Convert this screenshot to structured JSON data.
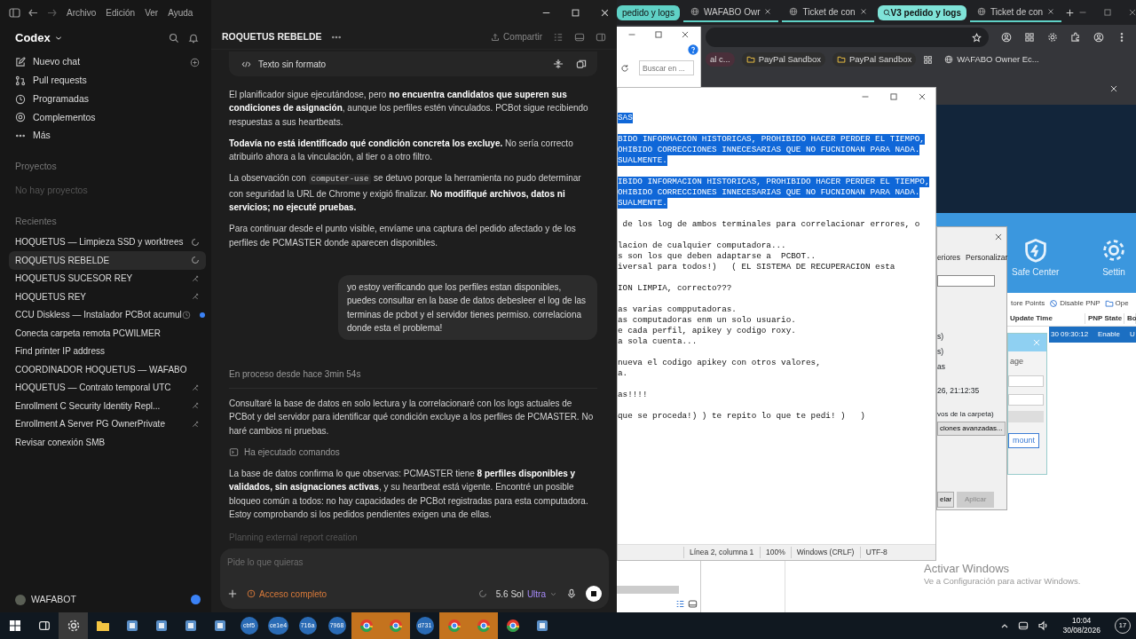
{
  "codex": {
    "menu": [
      "Archivo",
      "Edición",
      "Ver",
      "Ayuda"
    ],
    "app_name": "Codex",
    "nav": [
      {
        "kind": "new",
        "label": "Nuevo chat"
      },
      {
        "kind": "pr",
        "label": "Pull requests"
      },
      {
        "kind": "clock",
        "label": "Programadas"
      },
      {
        "kind": "plugin",
        "label": "Complementos"
      },
      {
        "kind": "more",
        "label": "Más"
      }
    ],
    "projects": {
      "heading": "Proyectos",
      "empty": "No hay proyectos"
    },
    "recents": {
      "heading": "Recientes",
      "items": [
        {
          "label": "HOQUETUS — Limpieza SSD y worktrees",
          "selected": false,
          "kind": "spinner"
        },
        {
          "label": "ROQUETUS REBELDE",
          "selected": true,
          "kind": "spinner"
        },
        {
          "label": "HOQUETUS SUCESOR REY",
          "selected": false,
          "kind": "branch"
        },
        {
          "label": "HOQUETUS REY",
          "selected": false,
          "kind": "branch"
        },
        {
          "label": "CCU Diskless — Instalador PCBot acumul",
          "selected": false,
          "kind": "unread"
        },
        {
          "label": "Conecta carpeta remota PCWILMER",
          "selected": false,
          "kind": "plain"
        },
        {
          "label": "Find printer IP address",
          "selected": false,
          "kind": "plain"
        },
        {
          "label": "COORDINADOR HOQUETUS — WAFABO",
          "selected": false,
          "kind": "plain"
        },
        {
          "label": "HOQUETUS — Contrato temporal UTC",
          "selected": false,
          "kind": "branch"
        },
        {
          "label": "Enrollment C Security Identity Repl...",
          "selected": false,
          "kind": "branch"
        },
        {
          "label": "Enrollment A Server PG OwnerPrivate",
          "selected": false,
          "kind": "branch"
        },
        {
          "label": "Revisar conexión SMB",
          "selected": false,
          "kind": "plain"
        }
      ]
    },
    "user": {
      "name": "WAFABOT"
    },
    "chat": {
      "title": "ROQUETUS REBELDE",
      "share": "Compartir",
      "code_block": "Texto sin formato",
      "messages": [
        {
          "kind": "assistant",
          "segments": [
            {
              "kind": "text",
              "text": "El planificador sigue ejecutándose, pero **no encuentra candidatos que superen sus condiciones de asignación**, aunque los perfiles estén vinculados. PCBot sigue recibiendo respuestas a sus heartbeats."
            }
          ]
        },
        {
          "kind": "assistant",
          "segments": [
            {
              "kind": "text",
              "text": "**Todavía no está identificado qué condición concreta los excluye.** No sería correcto atribuirlo ahora a la vinculación, al tier o a otro filtro."
            }
          ]
        },
        {
          "kind": "assistant",
          "segments": [
            {
              "kind": "text",
              "text": "La observación con "
            },
            {
              "kind": "code",
              "text": "computer-use"
            },
            {
              "kind": "text",
              "text": " se detuvo porque la herramienta no pudo determinar con seguridad la URL de Chrome y exigió finalizar. **No modifiqué archivos, datos ni servicios; no ejecuté pruebas.**"
            }
          ]
        },
        {
          "kind": "assistant",
          "segments": [
            {
              "kind": "text",
              "text": "Para continuar desde el punto visible, envíame una captura del pedido afectado y de los perfiles de PCMASTER donde aparecen disponibles."
            }
          ]
        },
        {
          "kind": "user",
          "segments": [
            {
              "kind": "text",
              "text": "yo estoy verificando que los perfiles estan disponibles, puedes consultar en la base de datos debesleer el log de las terminas de pcbot y el servidor tienes permiso. correlaciona donde esta el problema!"
            }
          ]
        },
        {
          "kind": "status",
          "segments": [
            {
              "kind": "text",
              "text": "En proceso desde hace 3min 54s"
            }
          ]
        },
        {
          "kind": "assistant",
          "segments": [
            {
              "kind": "text",
              "text": "Consultaré la base de datos en solo lectura y la correlacionaré con los logs actuales de PCBot y del servidor para identificar qué condición excluye a los perfiles de PCMASTER. No haré cambios ni pruebas."
            }
          ]
        },
        {
          "kind": "tool",
          "segments": [
            {
              "kind": "text",
              "text": "Ha ejecutado comandos"
            }
          ]
        },
        {
          "kind": "assistant",
          "segments": [
            {
              "kind": "text",
              "text": "La base de datos confirma lo que observas: PCMASTER tiene **8 perfiles disponibles y validados, sin asignaciones activas**, y su heartbeat está vigente. Encontré un posible bloqueo común a todos: no hay capacidades de PCBot registradas para esta computadora. Estoy comprobando si los pedidos pendientes exigen una de ellas."
            }
          ]
        },
        {
          "kind": "thinking",
          "segments": [
            {
              "kind": "text",
              "text": "Planning external report creation"
            }
          ]
        }
      ],
      "composer": {
        "placeholder": "Pide lo que quieras",
        "access": "Acceso completo",
        "model": "5.6 Sol",
        "effort": "Ultra"
      }
    }
  },
  "browser": {
    "tabs": [
      {
        "kind": "group",
        "label": "pedido y logs",
        "selected": false
      },
      {
        "kind": "tab",
        "label": "WAFABO Owr",
        "selected": false
      },
      {
        "kind": "tab",
        "label": "Ticket de con",
        "selected": false
      },
      {
        "kind": "group",
        "label": "V3 pedido y logs",
        "selected": true
      },
      {
        "kind": "tab",
        "label": "Ticket de con",
        "selected": false
      }
    ],
    "bookmarks": [
      {
        "kind": "partial",
        "label": "al c..."
      },
      {
        "kind": "folder",
        "label": "PayPal Sandbox"
      },
      {
        "kind": "folder",
        "label": "PayPal Sandbox"
      },
      {
        "kind": "apps"
      },
      {
        "kind": "site",
        "label": "WAFABO Owner Ec..."
      }
    ]
  },
  "explorer": {
    "search_placeholder": "Buscar en ..."
  },
  "notepad": {
    "paragraphs": [
      {
        "selected": true,
        "lines": [
          "SAS"
        ]
      },
      {
        "selected": true,
        "lines": [
          "BIDO INFORMACION HISTORICAS, PROHIBIDO HACER PERDER EL TIEMPO,",
          "OHIBIDO CORRECCIONES INNECESARIAS QUE NO FUCNIONAN PARA NADA.",
          "SUALMENTE."
        ]
      },
      {
        "selected": true,
        "lines": [
          "IBIDO INFORMACION HISTORICAS, PROHIBIDO HACER PERDER EL TIEMPO,",
          "OHIBIDO CORRECCIONES INNECESARIAS QUE NO FUCNIONAN PARA NADA.",
          "SUALMENTE."
        ]
      },
      {
        "selected": false,
        "lines": [
          " de los log de ambos terminales para correlacionar errores, o"
        ]
      },
      {
        "selected": false,
        "lines": [
          "lacion de cualquier computadora...",
          "s son los que deben adaptarse a  PCBOT..",
          "iversal para todos!)   ( EL SISTEMA DE RECUPERACION esta"
        ]
      },
      {
        "selected": false,
        "lines": [
          "ION LIMPIA, correcto???"
        ]
      },
      {
        "selected": false,
        "lines": [
          "as varias compputadoras.",
          "as computadoras enm un solo usuario.",
          "e cada perfil, apikey y codigo roxy.",
          "a sola cuenta..."
        ]
      },
      {
        "selected": false,
        "lines": [
          "nueva el codigo apikey con otros valores,",
          "a."
        ]
      },
      {
        "selected": false,
        "lines": [
          "as!!!!"
        ]
      },
      {
        "selected": false,
        "lines": [
          "que se proceda!) ) te repito lo que te pedi! )   )"
        ]
      }
    ],
    "status": [
      "Línea 2, columna 1",
      "100%",
      "Windows (CRLF)",
      "UTF-8"
    ]
  },
  "security_app": {
    "tiles": [
      {
        "kind": "shield",
        "label": "Safe Center"
      },
      {
        "kind": "gear",
        "label": "Settin"
      }
    ],
    "toolbar": [
      {
        "kind": "restore",
        "label": "tore Points"
      },
      {
        "kind": "disable",
        "label": "Disable PNP"
      },
      {
        "kind": "open",
        "label": "Ope"
      }
    ],
    "columns": [
      "Update Time",
      "PNP State",
      "Bo"
    ],
    "row": {
      "cells": [
        "30 09:30:12",
        "Enable",
        "U"
      ],
      "selected": true
    },
    "dialog": {
      "label": "age",
      "button": "mount"
    }
  },
  "properties": {
    "tabs": [
      "eriores",
      "Personalizar"
    ],
    "items": [
      "s)",
      "s)",
      "as"
    ],
    "date": "26, 21:12:35",
    "note": "vos de la carpeta)",
    "advanced": "ciones avanzadas...",
    "cancel": "elar",
    "apply": "Aplicar"
  },
  "activation": {
    "title": "Activar Windows",
    "subtitle": "Ve a Configuración para activar Windows."
  },
  "taskbar": {
    "apps": [
      {
        "kind": "start",
        "highlighted": false
      },
      {
        "kind": "taskview",
        "highlighted": false
      },
      {
        "kind": "codex",
        "highlighted": true
      },
      {
        "kind": "folder",
        "highlighted": false
      },
      {
        "kind": "app",
        "highlighted": false
      },
      {
        "kind": "app",
        "highlighted": false
      },
      {
        "kind": "app",
        "highlighted": false
      },
      {
        "kind": "app",
        "highlighted": false
      },
      {
        "kind": "badge",
        "label": "cbf5",
        "highlighted": false
      },
      {
        "kind": "badge",
        "label": "ce1e4",
        "highlighted": false
      },
      {
        "kind": "badge",
        "label": "716a",
        "highlighted": false
      },
      {
        "kind": "badge",
        "label": "7968",
        "highlighted": false
      },
      {
        "kind": "chrome",
        "highlighted": true
      },
      {
        "kind": "chrome",
        "highlighted": true
      },
      {
        "kind": "badge",
        "label": "d731",
        "highlighted": false
      },
      {
        "kind": "chrome",
        "highlighted": true
      },
      {
        "kind": "chrome",
        "highlighted": true
      },
      {
        "kind": "chrome",
        "highlighted": false
      },
      {
        "kind": "app",
        "highlighted": false
      }
    ],
    "time": "10:04",
    "date": "30/08/2026",
    "notifications": "17"
  }
}
